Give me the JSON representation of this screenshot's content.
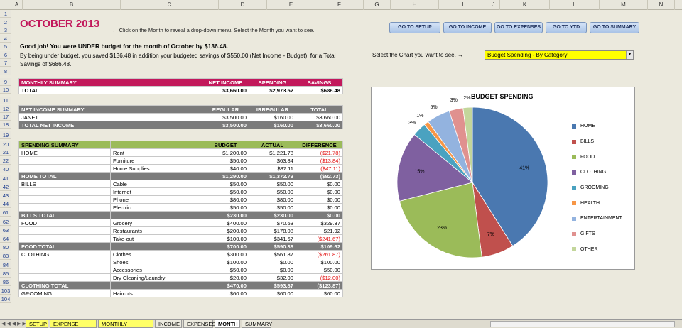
{
  "columns": [
    "A",
    "B",
    "C",
    "D",
    "E",
    "F",
    "G",
    "H",
    "I",
    "J",
    "K",
    "L",
    "M",
    "N"
  ],
  "row_numbers": [
    "1",
    "2",
    "3",
    "4",
    "5",
    "6",
    "7",
    "8",
    "9",
    "10",
    "11",
    "12",
    "17",
    "18",
    "19",
    "20",
    "21",
    "22",
    "40",
    "41",
    "42",
    "43",
    "44",
    "61",
    "62",
    "63",
    "64",
    "80",
    "83",
    "84",
    "85",
    "86",
    "103",
    "104"
  ],
  "header": {
    "title": "OCTOBER 2013",
    "hint": "← Click on the Month to reveal a drop-down menu.  Select the Month you want to see.",
    "message_bold": "Good job!  You were UNDER budget for the month of October by $136.48.",
    "message_detail": "By being under budget, you saved $136.48 in addition your budgeted savings of $550.00 (Net Income - Budget), for a Total Savings of $686.48."
  },
  "nav_buttons": [
    "GO TO SETUP",
    "GO TO INCOME",
    "GO TO EXPENSES",
    "GO TO YTD",
    "GO TO SUMMARY"
  ],
  "chart_selector": {
    "label": "Select the Chart you want to see.  →",
    "value": "Budget Spending - By Category"
  },
  "monthly_summary": {
    "headers": [
      "MONTHLY SUMMARY",
      "NET INCOME",
      "SPENDING",
      "SAVINGS"
    ],
    "row": [
      "TOTAL",
      "$3,660.00",
      "$2,973.52",
      "$686.48"
    ]
  },
  "net_income_summary": {
    "headers": [
      "NET INCOME SUMMARY",
      "REGULAR",
      "IRREGULAR",
      "TOTAL"
    ],
    "rows": [
      [
        "JANET",
        "$3,500.00",
        "$160.00",
        "$3,660.00"
      ]
    ],
    "total": [
      "TOTAL NET INCOME",
      "$3,500.00",
      "$160.00",
      "$3,660.00"
    ]
  },
  "spending_summary": {
    "headers": [
      "SPENDING SUMMARY",
      "",
      "BUDGET",
      "ACTUAL",
      "DIFFERENCE"
    ],
    "rows": [
      {
        "type": "item",
        "cells": [
          "HOME",
          "Rent",
          "$1,200.00",
          "$1,221.78",
          "($21.78)"
        ],
        "neg": true
      },
      {
        "type": "item",
        "cells": [
          "",
          "Furniture",
          "$50.00",
          "$63.84",
          "($13.84)"
        ],
        "neg": true
      },
      {
        "type": "item",
        "cells": [
          "",
          "Home Supplies",
          "$40.00",
          "$87.11",
          "($47.11)"
        ],
        "neg": true
      },
      {
        "type": "total",
        "cells": [
          "HOME TOTAL",
          "",
          "$1,290.00",
          "$1,372.73",
          "($82.73)"
        ],
        "neg": true
      },
      {
        "type": "item",
        "cells": [
          "BILLS",
          "Cable",
          "$50.00",
          "$50.00",
          "$0.00"
        ],
        "neg": false
      },
      {
        "type": "item",
        "cells": [
          "",
          "Internet",
          "$50.00",
          "$50.00",
          "$0.00"
        ],
        "neg": false
      },
      {
        "type": "item",
        "cells": [
          "",
          "Phone",
          "$80.00",
          "$80.00",
          "$0.00"
        ],
        "neg": false
      },
      {
        "type": "item",
        "cells": [
          "",
          "Electric",
          "$50.00",
          "$50.00",
          "$0.00"
        ],
        "neg": false
      },
      {
        "type": "total",
        "cells": [
          "BILLS TOTAL",
          "",
          "$230.00",
          "$230.00",
          "$0.00"
        ],
        "neg": false
      },
      {
        "type": "item",
        "cells": [
          "FOOD",
          "Grocery",
          "$400.00",
          "$70.63",
          "$329.37"
        ],
        "neg": false
      },
      {
        "type": "item",
        "cells": [
          "",
          "Restaurants",
          "$200.00",
          "$178.08",
          "$21.92"
        ],
        "neg": false
      },
      {
        "type": "item",
        "cells": [
          "",
          "Take-out",
          "$100.00",
          "$341.67",
          "($241.67)"
        ],
        "neg": true
      },
      {
        "type": "total",
        "cells": [
          "FOOD TOTAL",
          "",
          "$700.00",
          "$590.38",
          "$109.62"
        ],
        "neg": false
      },
      {
        "type": "item",
        "cells": [
          "CLOTHING",
          "Clothes",
          "$300.00",
          "$561.87",
          "($261.87)"
        ],
        "neg": true
      },
      {
        "type": "item",
        "cells": [
          "",
          "Shoes",
          "$100.00",
          "$0.00",
          "$100.00"
        ],
        "neg": false
      },
      {
        "type": "item",
        "cells": [
          "",
          "Accessories",
          "$50.00",
          "$0.00",
          "$50.00"
        ],
        "neg": false
      },
      {
        "type": "item",
        "cells": [
          "",
          "Dry Cleaning/Laundry",
          "$20.00",
          "$32.00",
          "($12.00)"
        ],
        "neg": true
      },
      {
        "type": "total",
        "cells": [
          "CLOTHING TOTAL",
          "",
          "$470.00",
          "$593.87",
          "($123.87)"
        ],
        "neg": true
      },
      {
        "type": "item",
        "cells": [
          "GROOMING",
          "Haircuts",
          "$60.00",
          "$60.00",
          "$60.00"
        ],
        "neg": false
      }
    ]
  },
  "chart_data": {
    "type": "pie",
    "title": "BUDGET SPENDING",
    "categories": [
      "HOME",
      "BILLS",
      "FOOD",
      "CLOTHING",
      "GROOMING",
      "HEALTH",
      "ENTERTAINMENT",
      "GIFTS",
      "OTHER"
    ],
    "values": [
      41,
      7,
      23,
      15,
      3,
      1,
      5,
      3,
      2
    ],
    "labels": [
      "41%",
      "7%",
      "23%",
      "15%",
      "3%",
      "1%",
      "5%",
      "3%",
      "2%"
    ],
    "colors": [
      "#4a78b0",
      "#c0504d",
      "#9bbb59",
      "#7f60a0",
      "#4aa2c0",
      "#f79646",
      "#93b3df",
      "#e0918f",
      "#c3d69b"
    ],
    "legend_position": "right"
  },
  "sheet_tabs": [
    "SETUP",
    "EXPENSE SETUP",
    "MONTHLY BUDGETS",
    "INCOME",
    "EXPENSES",
    "MONTH",
    "SUMMARY"
  ]
}
